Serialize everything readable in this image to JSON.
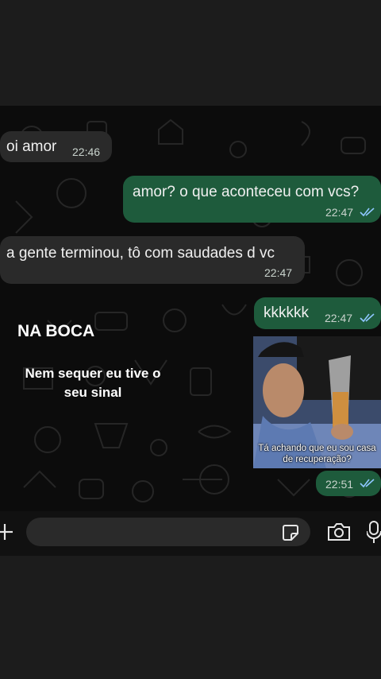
{
  "colors": {
    "incoming_bubble": "#2a2a2a",
    "outgoing_bubble": "#1e5b3c",
    "read_ticks": "#8fc7ff",
    "chat_background": "#0c0c0c"
  },
  "messages": [
    {
      "text": "oi amor",
      "time": "22:46",
      "direction": "in"
    },
    {
      "text": "amor? o que aconteceu com vcs?",
      "time": "22:47",
      "direction": "out",
      "status": "read"
    },
    {
      "text": "a gente terminou, tô com saudades d vc",
      "time": "22:47",
      "direction": "in"
    },
    {
      "text": "kkkkkk",
      "time": "22:47",
      "direction": "out",
      "status": "read"
    },
    {
      "type": "image",
      "caption": "Tá achando que eu sou casa de recuperação?",
      "time": "22:51",
      "direction": "out",
      "status": "read"
    }
  ],
  "overlay": {
    "title": "NA BOCA",
    "subtitle": "Nem sequer eu tive o seu sinal"
  },
  "composer": {
    "placeholder": "",
    "icons": [
      "plus-icon",
      "sticker-icon",
      "camera-icon",
      "mic-icon"
    ]
  }
}
